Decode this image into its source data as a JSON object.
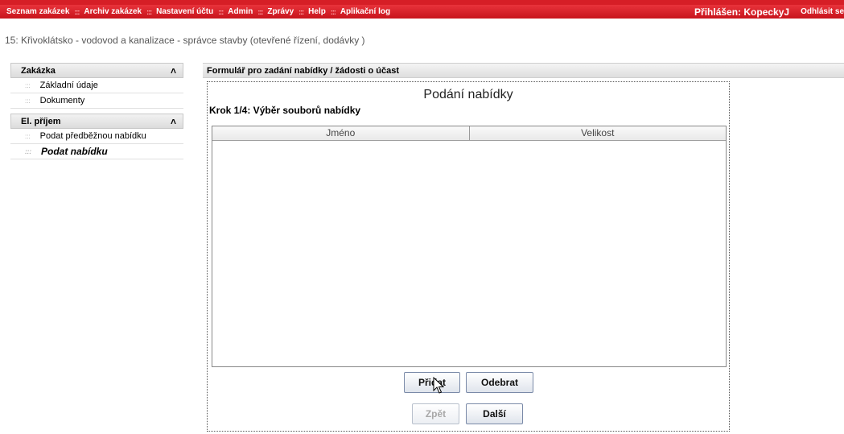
{
  "topnav": {
    "items": [
      "Seznam zakázek",
      "Archiv zakázek",
      "Nastavení účtu",
      "Admin",
      "Zprávy",
      "Help",
      "Aplikační log"
    ],
    "separator": ":::",
    "user_label": "Přihlášen: KopeckyJ",
    "logout_label": "Odhlásit se"
  },
  "breadcrumb": "15: Křivoklátsko - vodovod a kanalizace - správce stavby (otevřené řízení, dodávky )",
  "sidebar": {
    "sections": [
      {
        "title": "Zakázka",
        "items": [
          "Základní údaje",
          "Dokumenty"
        ]
      },
      {
        "title": "El. příjem",
        "items": [
          "Podat předběžnou nabídku",
          "Podat nabídku"
        ]
      }
    ],
    "active_item": "Podat nabídku"
  },
  "panel": {
    "header": "Formulář pro zadání nabídky / žádosti o účast",
    "title": "Podání nabídky",
    "step": "Krok 1/4: Výběr souborů nabídky",
    "table": {
      "columns": [
        "Jméno",
        "Velikost"
      ],
      "rows": []
    },
    "buttons": {
      "add": "Přidat",
      "remove": "Odebrat",
      "back": "Zpět",
      "next": "Další"
    }
  },
  "colors": {
    "accent": "#d61e26",
    "button_border": "#7a8aa8"
  },
  "icons": {
    "collapse": "double-chevron-up-icon",
    "bullet": "dots-bullet-icon",
    "cursor": "pointer-cursor-icon"
  }
}
